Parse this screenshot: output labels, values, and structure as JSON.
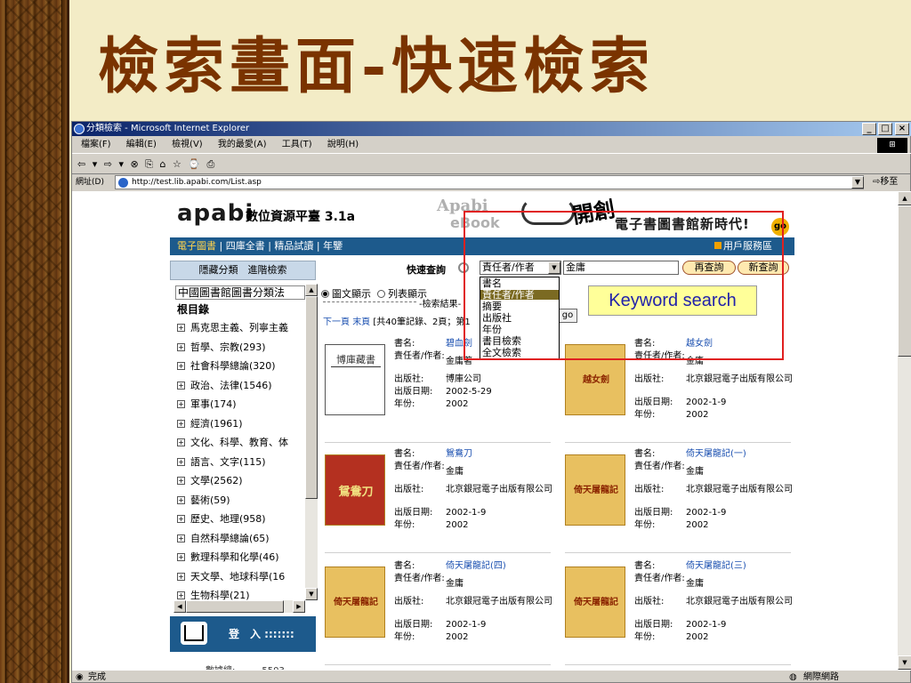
{
  "slide": {
    "title": "檢索畫面-快速檢索"
  },
  "window": {
    "title": "分類檢索 - Microsoft Internet Explorer",
    "min": "_",
    "max": "□",
    "close": "×",
    "menu": [
      "檔案(F)",
      "編輯(E)",
      "檢視(V)",
      "我的最愛(A)",
      "工具(T)",
      "說明(H)"
    ],
    "toolbar_icons": "⇦ ▾ ⇨ ▾ ⊗ ⎘ ⌂ ☆ ⌚ ⎙",
    "address_label": "網址(D)",
    "address": "http://test.lib.apabi.com/List.asp",
    "go_label": "移至",
    "status": "完成",
    "zone": "網際網路"
  },
  "page": {
    "logo": "apabi",
    "logo_sub": "數位資源平臺 3.1a",
    "banner": {
      "apabi": "Apabi",
      "ebook": "eBook",
      "kai": "開創",
      "slogan": "電子書圖書館新時代!",
      "go": "go"
    },
    "nav": [
      "電子圖書",
      "四庫全書",
      "精品試讀",
      "年鑒"
    ],
    "nav_right": "用戶服務區",
    "left_panel": {
      "header": "隱藏分類　進階檢索",
      "selected": "中國圖書館圖書分類法",
      "root": "根目錄",
      "items": [
        "馬克思主義、列寧主義",
        "哲學、宗教(293)",
        "社會科學總論(320)",
        "政治、法律(1546)",
        "軍事(174)",
        "經濟(1961)",
        "文化、科學、教育、体",
        "語言、文字(115)",
        "文學(2562)",
        "藝術(59)",
        "歷史、地理(958)",
        "自然科學總論(65)",
        "數理科學和化學(46)",
        "天文學、地球科學(16",
        "生物科學(21)"
      ],
      "bottom_label": "登　入 :::::::",
      "stats": "數據總:　　　5503"
    },
    "search": {
      "label": "快速查詢",
      "field": "責任者/作者",
      "keyword": "金庸",
      "btn_again": "再查詢",
      "btn_new": "新查詢",
      "options": [
        "書名",
        "責任者/作者",
        "摘要",
        "出版社",
        "年份",
        "書目檢索",
        "全文檢索"
      ],
      "radio_image": "圖文顯示",
      "radio_list": "列表顯示",
      "result_label": "-檢索結果-",
      "pager_next": "下一頁",
      "pager_last": "末頁",
      "pager_info": "[共40筆記錄、2頁；第1",
      "pager_go": "go"
    },
    "callout": "Keyword search",
    "labels": {
      "title": "書名:",
      "author": "責任者/作者:",
      "publisher": "出版社:",
      "date": "出版日期:",
      "year": "年份:"
    },
    "books": [
      {
        "cover": "博庫藏書",
        "title": "碧血劍",
        "author": "金庸著",
        "publisher": "博庫公司",
        "date": "2002-5-29",
        "year": "2002"
      },
      {
        "cover": "越女劍",
        "title": "越女劍",
        "author": "金庸",
        "publisher": "北京銀冠電子出版有限公司",
        "date": "2002-1-9",
        "year": "2002"
      },
      {
        "cover": "鴛鴦刀",
        "title": "鴛鴦刀",
        "author": "金庸",
        "publisher": "北京銀冠電子出版有限公司",
        "date": "2002-1-9",
        "year": "2002"
      },
      {
        "cover": "倚天屠龍記",
        "title": "倚天屠龍記(一)",
        "author": "金庸",
        "publisher": "北京銀冠電子出版有限公司",
        "date": "2002-1-9",
        "year": "2002"
      },
      {
        "cover": "倚天屠龍記",
        "title": "倚天屠龍記(四)",
        "author": "金庸",
        "publisher": "北京銀冠電子出版有限公司",
        "date": "2002-1-9",
        "year": "2002"
      },
      {
        "cover": "倚天屠龍記",
        "title": "倚天屠龍記(三)",
        "author": "金庸",
        "publisher": "北京銀冠電子出版有限公司",
        "date": "2002-1-9",
        "year": "2002"
      }
    ]
  }
}
